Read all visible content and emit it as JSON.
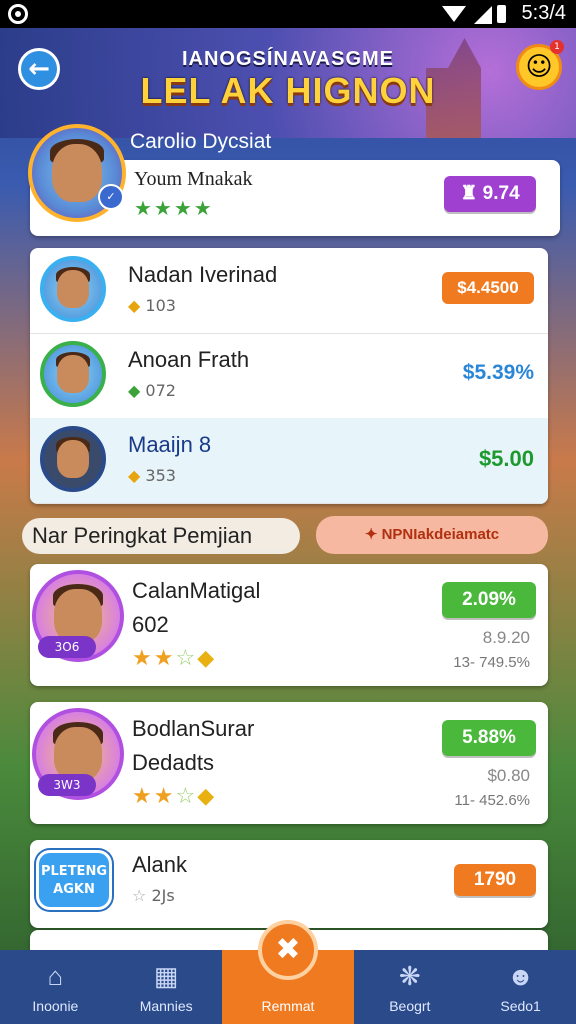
{
  "status_bar": {
    "time": "5:3/4"
  },
  "header": {
    "subtitle": "IANOGSÍNAVASGME",
    "title": "LEL AK HIGNON",
    "notification_count": "1"
  },
  "featured": {
    "label": "Carolio Dycsiat",
    "name": "Youm Mnakak",
    "value": "9.74"
  },
  "leaderboard": [
    {
      "name": "Nadan Iverinad",
      "score": "103",
      "value": "$4.4500"
    },
    {
      "name": "Anoan Frath",
      "score": "072",
      "value": "$5.39%"
    },
    {
      "name": "Maaijn 8",
      "score": "353",
      "value": "$5.00"
    }
  ],
  "section": {
    "title": "Nar Peringkat Pemjian",
    "action": "NPNIakdeiamatc"
  },
  "players": [
    {
      "name_line1": "CalanMatigal",
      "name_line2": "602",
      "level": "3O6",
      "value": "2.09%",
      "sub1": "8.9.20",
      "sub2": "13- 749.5%"
    },
    {
      "name_line1": "BodlanSurar",
      "name_line2": "Dedadts",
      "level": "3W3",
      "value": "5.88%",
      "sub1": "$0.80",
      "sub2": "11- 452.6%"
    }
  ],
  "partial": {
    "badge": "PLETENG AGKN",
    "name": "Alank",
    "score": "2Js",
    "value": "1790"
  },
  "nav": [
    {
      "label": "Inoonie",
      "icon": "home-icon"
    },
    {
      "label": "Mannies",
      "icon": "calendar-icon"
    },
    {
      "label": "Remmat",
      "icon": "close-icon"
    },
    {
      "label": "Beogrt",
      "icon": "puzzle-icon"
    },
    {
      "label": "Sedo1",
      "icon": "user-icon"
    }
  ]
}
